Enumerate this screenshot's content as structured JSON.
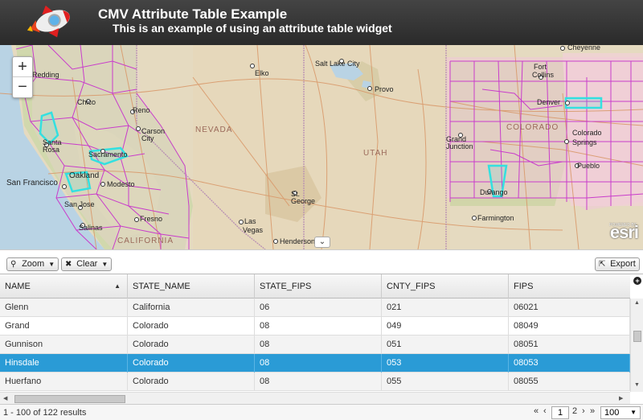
{
  "header": {
    "title": "CMV Attribute Table Example",
    "subtitle": "This is an example of using an attribute table widget"
  },
  "map": {
    "zoom_in": "+",
    "zoom_out": "−",
    "toggle": "⌄",
    "powered_by": "POWERED BY",
    "brand": "esri",
    "states": [
      "NEVADA",
      "UTAH",
      "COLORADO",
      "CALIFORNIA"
    ],
    "cities": [
      "Redding",
      "Chico",
      "Reno",
      "Carson City",
      "Santa Rosa",
      "Sacramento",
      "San Francisco",
      "Oakland",
      "Modesto",
      "San Jose",
      "Fresno",
      "Salinas",
      "Elko",
      "Salt Lake City",
      "Provo",
      "St. George",
      "Las Vegas",
      "Henderson",
      "Fort Collins",
      "Cheyenne",
      "Denver",
      "Colorado Springs",
      "Pueblo",
      "Grand Junction",
      "Durango",
      "Farmington"
    ]
  },
  "toolbar": {
    "zoom_label": "Zoom",
    "clear_label": "Clear",
    "export_label": "Export"
  },
  "table": {
    "columns": [
      "NAME",
      "STATE_NAME",
      "STATE_FIPS",
      "CNTY_FIPS",
      "FIPS"
    ],
    "sorted_column": "NAME",
    "rows": [
      [
        "Glenn",
        "California",
        "06",
        "021",
        "06021"
      ],
      [
        "Grand",
        "Colorado",
        "08",
        "049",
        "08049"
      ],
      [
        "Gunnison",
        "Colorado",
        "08",
        "051",
        "08051"
      ],
      [
        "Hinsdale",
        "Colorado",
        "08",
        "053",
        "08053"
      ],
      [
        "Huerfano",
        "Colorado",
        "08",
        "055",
        "08055"
      ]
    ],
    "selected_row": 3
  },
  "footer": {
    "results": "1 - 100 of 122 results",
    "first": "«",
    "prev": "‹",
    "current_page": "1",
    "next_page": "2",
    "next": "›",
    "last": "»",
    "page_size": "100"
  },
  "colors": {
    "header_bg": "#333333",
    "selection": "#2a9bd6",
    "county_lines": "#cc33cc",
    "highlight": "#33e0e0"
  }
}
